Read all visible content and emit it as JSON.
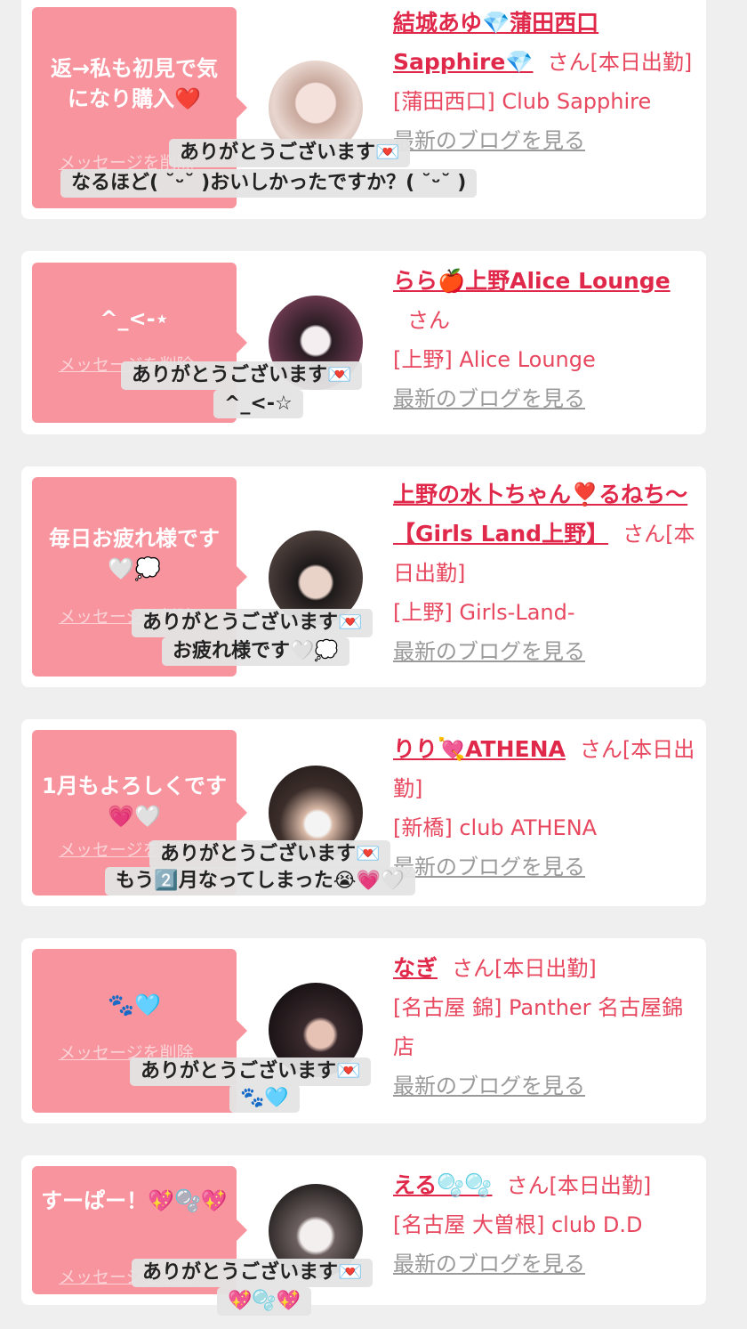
{
  "delete_label": "メッセージを削除",
  "blog_label": "最新のブログを見る",
  "san": "さん",
  "cards": [
    {
      "message": "返→私も初見で気になり購入❤️",
      "name": "結城あゆ💎蒲田西口Sapphire💎",
      "suffix": "さん[本日出勤]",
      "shop": "[蒲田西口] Club Sapphire",
      "reply_line1": "ありがとうございます💌",
      "reply_line2": "なるほど( ˘ᵕ˘ )おいしかったですか？( ˘ᵕ˘ )"
    },
    {
      "message": "^_<-⋆",
      "name": "らら🍎上野Alice Lounge",
      "suffix": "さん",
      "shop": "[上野] Alice Lounge",
      "reply_line1": "ありがとうございます💌",
      "reply_line2": "^_<-☆"
    },
    {
      "message": "毎日お疲れ様です🤍💭",
      "name": "上野の水卜ちゃん❣️るねち〜【Girls Land上野】",
      "suffix": "さん[本日出勤]",
      "shop": "[上野] Girls-Land-",
      "reply_line1": "ありがとうございます💌",
      "reply_line2": "お疲れ様です🤍💭"
    },
    {
      "message": "1月もよろしくです💗🤍",
      "name": "りり💘ATHENA",
      "suffix": "さん[本日出勤]",
      "shop": "[新橋] club ATHENA",
      "reply_line1": "ありがとうございます💌",
      "reply_line2": "もう2️⃣月なってしまった😭💗🤍"
    },
    {
      "message": "🐾🩵",
      "name": "なぎ",
      "suffix": "さん[本日出勤]",
      "shop": "[名古屋 錦] Panther 名古屋錦店",
      "reply_line1": "ありがとうございます💌",
      "reply_line2": "🐾🩵"
    },
    {
      "message": "すーぱー！💖🫧💖",
      "name": "える🫧🫧",
      "suffix": "さん[本日出勤]",
      "shop": "[名古屋 大曽根] club D.D",
      "reply_line1": "ありがとうございます💌",
      "reply_line2": "💖🫧💖"
    }
  ]
}
